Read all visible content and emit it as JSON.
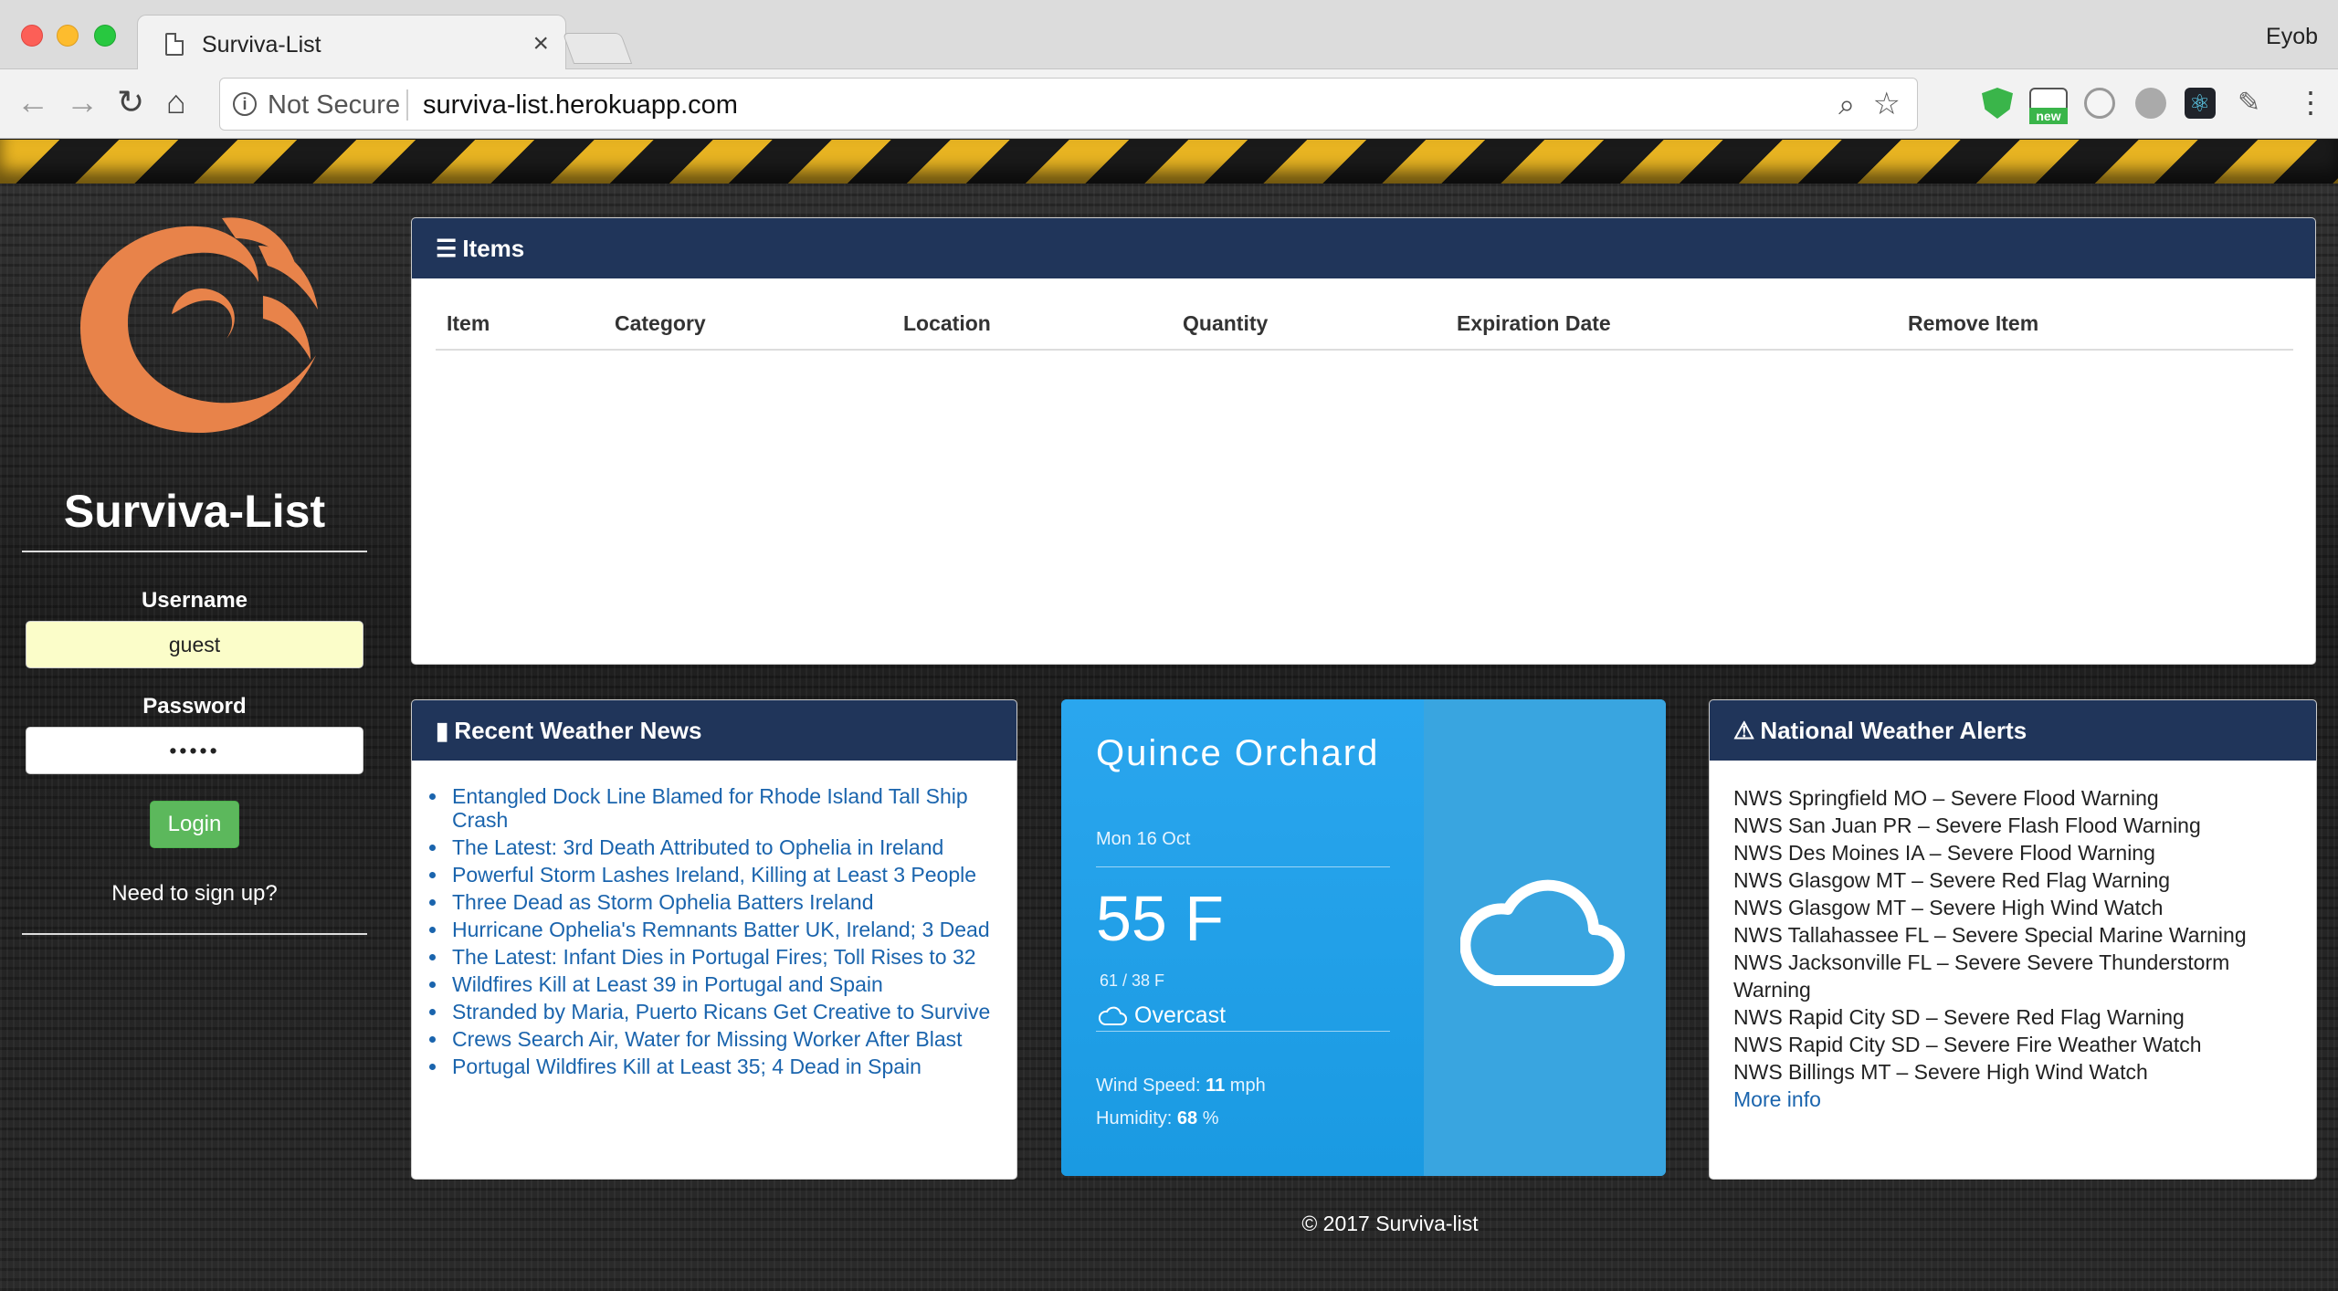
{
  "browser": {
    "tab_title": "Surviva-List",
    "tab_close": "×",
    "profile_name": "Eyob",
    "security_label": "Not Secure",
    "url": "surviva-list.herokuapp.com",
    "ext_new_badge": "new"
  },
  "sidebar": {
    "brand": "Surviva-List",
    "username_label": "Username",
    "username_value": "guest",
    "password_label": "Password",
    "password_value": "•••••",
    "login_label": "Login",
    "signup_text": "Need to sign up?",
    "logo_color": "#e8834a"
  },
  "items": {
    "title": "Items",
    "columns": [
      "Item",
      "Category",
      "Location",
      "Quantity",
      "Expiration Date",
      "Remove Item"
    ],
    "rows": []
  },
  "news": {
    "title": "Recent Weather News",
    "headlines": [
      "Entangled Dock Line Blamed for Rhode Island Tall Ship Crash",
      "The Latest: 3rd Death Attributed to Ophelia in Ireland",
      "Powerful Storm Lashes Ireland, Killing at Least 3 People",
      "Three Dead as Storm Ophelia Batters Ireland",
      "Hurricane Ophelia's Remnants Batter UK, Ireland; 3 Dead",
      "The Latest: Infant Dies in Portugal Fires; Toll Rises to 32",
      "Wildfires Kill at Least 39 in Portugal and Spain",
      "Stranded by Maria, Puerto Ricans Get Creative to Survive",
      "Crews Search Air, Water for Missing Worker After Blast",
      "Portugal Wildfires Kill at Least 35; 4 Dead in Spain"
    ]
  },
  "weather": {
    "city": "Quince Orchard",
    "date": "Mon 16 Oct",
    "temp": "55 F",
    "range": "61 / 38 F",
    "condition": "Overcast",
    "wind_label": "Wind Speed: ",
    "wind_value": "11",
    "wind_unit": " mph",
    "humidity_label": "Humidity: ",
    "humidity_value": "68",
    "humidity_unit": " %",
    "icon": "cloud-icon"
  },
  "alerts": {
    "title": "National Weather Alerts",
    "items": [
      "NWS Springfield MO – Severe Flood Warning",
      "NWS San Juan PR – Severe Flash Flood Warning",
      "NWS Des Moines IA – Severe Flood Warning",
      "NWS Glasgow MT – Severe Red Flag Warning",
      "NWS Glasgow MT – Severe High Wind Watch",
      "NWS Tallahassee FL – Severe Special Marine Warning",
      "NWS Jacksonville FL – Severe Severe Thunderstorm Warning",
      "NWS Rapid City SD – Severe Red Flag Warning",
      "NWS Rapid City SD – Severe Fire Weather Watch",
      "NWS Billings MT – Severe High Wind Watch"
    ],
    "more": "More info"
  },
  "footer": {
    "text": "© 2017 Surviva-list"
  },
  "colors": {
    "panel_header": "#20355a",
    "link": "#1a64ad",
    "login_button": "#5cb85c",
    "weather_card": "#1e9ee6",
    "hazard_yellow": "#e8b422"
  }
}
